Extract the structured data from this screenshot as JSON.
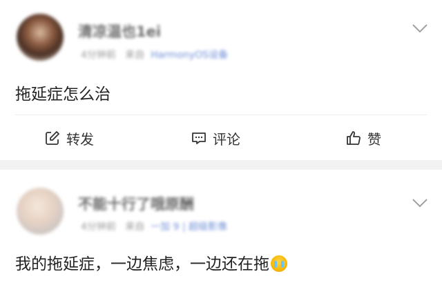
{
  "posts": [
    {
      "author": "清凉温也1ei",
      "meta_time": "4分钟前",
      "meta_source": "HarmonyOS设备",
      "content": "拖延症怎么治",
      "actions": {
        "repost": "转发",
        "comment": "评论",
        "like": "赞"
      }
    },
    {
      "author": "不能十行了哦原酬",
      "meta_time": "4分钟前",
      "meta_source": "一加 9 | 超级影像",
      "content": "我的拖延症，一边焦虑，一边还在拖"
    }
  ],
  "icons": {
    "repost": "edit-square-icon",
    "comment": "comment-bubble-icon",
    "like": "thumbs-up-icon",
    "menu": "chevron-down-icon",
    "emoji": "crying-face-emoji-icon"
  }
}
